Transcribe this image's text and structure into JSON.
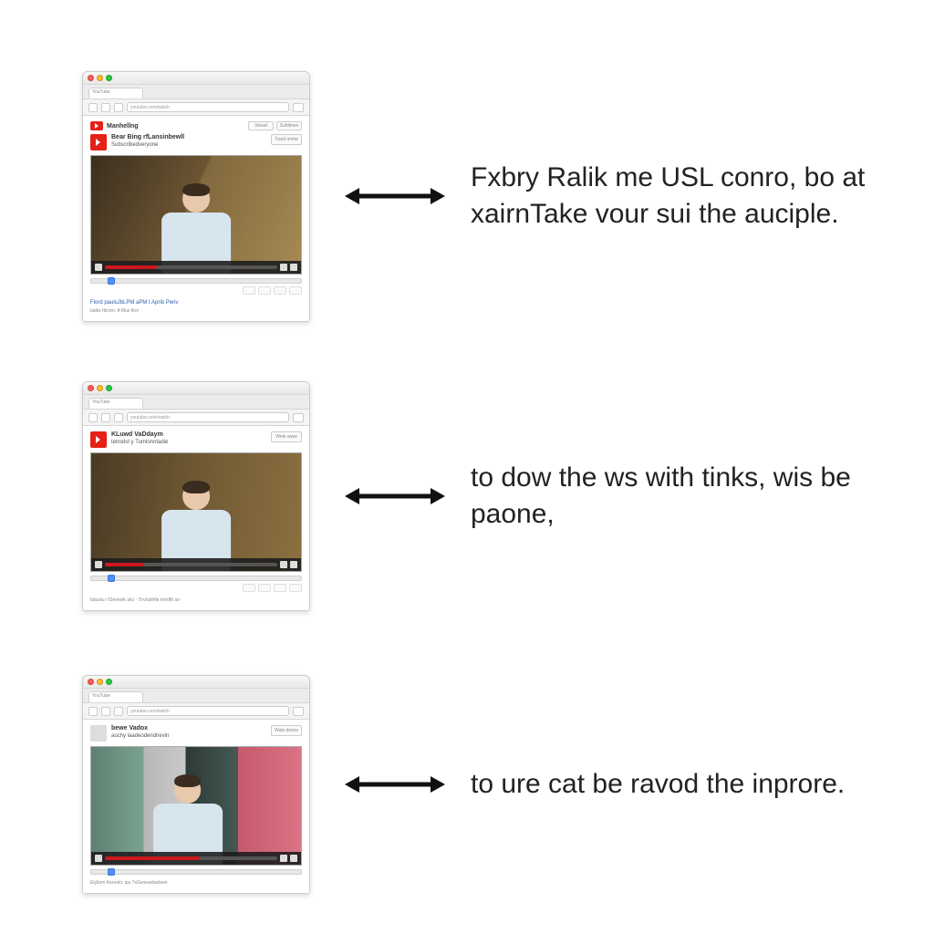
{
  "rows": [
    {
      "browser": {
        "tab_label": "YouTube",
        "url": "youtube.com/watch",
        "header_title": "Manhellng",
        "header_button1": "Inload",
        "header_button2": "Sublimes",
        "channel_title": "Bear Bing rfLansinbewll",
        "channel_sub": "Subscribedveryone",
        "channel_button": "Tised imme",
        "meta1": "Flord paulsJbLPM aPM t Aprib Periv",
        "meta2": "batlw  Ittcorn.  A Mus firer",
        "scene": "scene1"
      },
      "caption": "Fxbry Ralik me USL conro, bo at xairnTake vour sui the auciple."
    },
    {
      "browser": {
        "tab_label": "YouTube",
        "url": "youtube.com/watch",
        "header_title": "",
        "header_button1": "",
        "header_button2": "",
        "channel_title": "KLuwd VaDdaym",
        "channel_sub": "tetrodst y Tumlonntadie",
        "channel_button": "Wele www",
        "meta1": "bdusla r fGemwtk  aks - Tirvhathfle trentfb an",
        "meta2": "",
        "scene": "scene2"
      },
      "caption": "to dow the ws with tinks, wis be paone,"
    },
    {
      "browser": {
        "tab_label": "YouTube",
        "url": "youtube.com/watch",
        "header_title": "",
        "header_button1": "",
        "header_button2": "",
        "channel_title": "bewe Vadox",
        "channel_sub": "auchy  laadeodendrievin",
        "channel_button": "Wals deess",
        "meta1": "Etyllom  Kernekt. ips  7xGeneartiavbwn",
        "meta2": "",
        "scene": "scene3"
      },
      "caption": "to ure cat be ravod the inprore."
    }
  ],
  "arrow_label": "bidirectional-arrow"
}
